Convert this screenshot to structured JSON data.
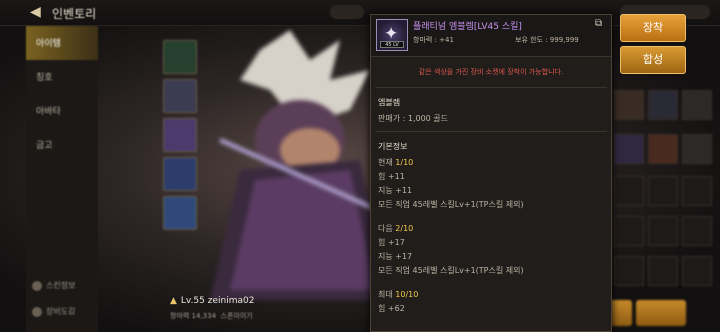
{
  "topbar": {
    "title": "인벤토리"
  },
  "side_nav": {
    "items": [
      {
        "label": "아이템",
        "active": true
      },
      {
        "label": "칭호",
        "active": false
      },
      {
        "label": "아바타",
        "active": false
      },
      {
        "label": "금고",
        "active": false
      }
    ],
    "bottom_items": [
      "스킨정보",
      "장비도감"
    ]
  },
  "character": {
    "level_name": "Lv.55 zeinima02",
    "sub_label": "항마력 14,334",
    "sub_label_2": "스폰아이기"
  },
  "buttons": {
    "equip": "장착",
    "craft": "합성"
  },
  "tooltip": {
    "name": "플래티넘 엠블렘[LV45 스킬]",
    "icon_level": "45 LV",
    "power": "항마력 : +41",
    "owned": "보유 한도 : 999,999",
    "warning": "같은 색상을 가진 장비 소켓에 장착이 가능합니다.",
    "item_type": "엠블렘",
    "price": "판매가 : 1,000 골드",
    "section_title": "기본정보",
    "blocks": [
      {
        "title_prefix": "현재",
        "title_value": "1/10",
        "lines": [
          "힘 +11",
          "지능 +11",
          "모든 직업 45레벨 스킬Lv+1(TP스킬 제외)"
        ]
      },
      {
        "title_prefix": "다음",
        "title_value": "2/10",
        "lines": [
          "힘 +17",
          "지능 +17",
          "모든 직업 45레벨 스킬Lv+1(TP스킬 제외)"
        ]
      },
      {
        "title_prefix": "최대",
        "title_value": "10/10",
        "lines": [
          "힘 +62"
        ]
      }
    ]
  },
  "icons": [
    "back-arrow-icon",
    "external-link-icon",
    "platinum-cross-icon"
  ],
  "colors": {
    "accent_gold": "#e7a23b",
    "item_name_purple": "#c78ff0",
    "warning_red": "#e0584e",
    "highlight_yellow": "#f2c94c"
  }
}
